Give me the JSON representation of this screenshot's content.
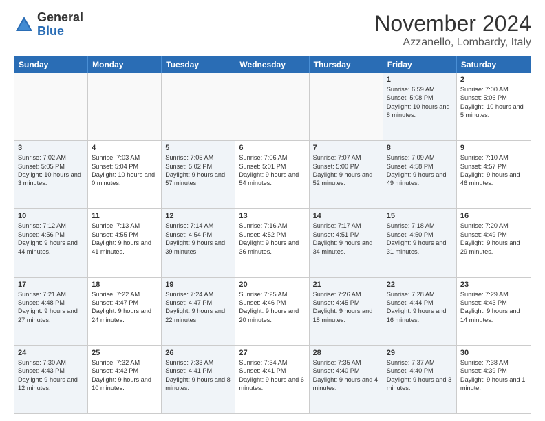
{
  "logo": {
    "general": "General",
    "blue": "Blue"
  },
  "title": "November 2024",
  "location": "Azzanello, Lombardy, Italy",
  "weekdays": [
    "Sunday",
    "Monday",
    "Tuesday",
    "Wednesday",
    "Thursday",
    "Friday",
    "Saturday"
  ],
  "rows": [
    [
      {
        "day": "",
        "info": "",
        "empty": true
      },
      {
        "day": "",
        "info": "",
        "empty": true
      },
      {
        "day": "",
        "info": "",
        "empty": true
      },
      {
        "day": "",
        "info": "",
        "empty": true
      },
      {
        "day": "",
        "info": "",
        "empty": true
      },
      {
        "day": "1",
        "info": "Sunrise: 6:59 AM\nSunset: 5:08 PM\nDaylight: 10 hours and 8 minutes.",
        "shaded": true
      },
      {
        "day": "2",
        "info": "Sunrise: 7:00 AM\nSunset: 5:06 PM\nDaylight: 10 hours and 5 minutes.",
        "shaded": false
      }
    ],
    [
      {
        "day": "3",
        "info": "Sunrise: 7:02 AM\nSunset: 5:05 PM\nDaylight: 10 hours and 3 minutes.",
        "shaded": true
      },
      {
        "day": "4",
        "info": "Sunrise: 7:03 AM\nSunset: 5:04 PM\nDaylight: 10 hours and 0 minutes.",
        "shaded": false
      },
      {
        "day": "5",
        "info": "Sunrise: 7:05 AM\nSunset: 5:02 PM\nDaylight: 9 hours and 57 minutes.",
        "shaded": true
      },
      {
        "day": "6",
        "info": "Sunrise: 7:06 AM\nSunset: 5:01 PM\nDaylight: 9 hours and 54 minutes.",
        "shaded": false
      },
      {
        "day": "7",
        "info": "Sunrise: 7:07 AM\nSunset: 5:00 PM\nDaylight: 9 hours and 52 minutes.",
        "shaded": true
      },
      {
        "day": "8",
        "info": "Sunrise: 7:09 AM\nSunset: 4:58 PM\nDaylight: 9 hours and 49 minutes.",
        "shaded": true
      },
      {
        "day": "9",
        "info": "Sunrise: 7:10 AM\nSunset: 4:57 PM\nDaylight: 9 hours and 46 minutes.",
        "shaded": false
      }
    ],
    [
      {
        "day": "10",
        "info": "Sunrise: 7:12 AM\nSunset: 4:56 PM\nDaylight: 9 hours and 44 minutes.",
        "shaded": true
      },
      {
        "day": "11",
        "info": "Sunrise: 7:13 AM\nSunset: 4:55 PM\nDaylight: 9 hours and 41 minutes.",
        "shaded": false
      },
      {
        "day": "12",
        "info": "Sunrise: 7:14 AM\nSunset: 4:54 PM\nDaylight: 9 hours and 39 minutes.",
        "shaded": true
      },
      {
        "day": "13",
        "info": "Sunrise: 7:16 AM\nSunset: 4:52 PM\nDaylight: 9 hours and 36 minutes.",
        "shaded": false
      },
      {
        "day": "14",
        "info": "Sunrise: 7:17 AM\nSunset: 4:51 PM\nDaylight: 9 hours and 34 minutes.",
        "shaded": true
      },
      {
        "day": "15",
        "info": "Sunrise: 7:18 AM\nSunset: 4:50 PM\nDaylight: 9 hours and 31 minutes.",
        "shaded": true
      },
      {
        "day": "16",
        "info": "Sunrise: 7:20 AM\nSunset: 4:49 PM\nDaylight: 9 hours and 29 minutes.",
        "shaded": false
      }
    ],
    [
      {
        "day": "17",
        "info": "Sunrise: 7:21 AM\nSunset: 4:48 PM\nDaylight: 9 hours and 27 minutes.",
        "shaded": true
      },
      {
        "day": "18",
        "info": "Sunrise: 7:22 AM\nSunset: 4:47 PM\nDaylight: 9 hours and 24 minutes.",
        "shaded": false
      },
      {
        "day": "19",
        "info": "Sunrise: 7:24 AM\nSunset: 4:47 PM\nDaylight: 9 hours and 22 minutes.",
        "shaded": true
      },
      {
        "day": "20",
        "info": "Sunrise: 7:25 AM\nSunset: 4:46 PM\nDaylight: 9 hours and 20 minutes.",
        "shaded": false
      },
      {
        "day": "21",
        "info": "Sunrise: 7:26 AM\nSunset: 4:45 PM\nDaylight: 9 hours and 18 minutes.",
        "shaded": true
      },
      {
        "day": "22",
        "info": "Sunrise: 7:28 AM\nSunset: 4:44 PM\nDaylight: 9 hours and 16 minutes.",
        "shaded": true
      },
      {
        "day": "23",
        "info": "Sunrise: 7:29 AM\nSunset: 4:43 PM\nDaylight: 9 hours and 14 minutes.",
        "shaded": false
      }
    ],
    [
      {
        "day": "24",
        "info": "Sunrise: 7:30 AM\nSunset: 4:43 PM\nDaylight: 9 hours and 12 minutes.",
        "shaded": true
      },
      {
        "day": "25",
        "info": "Sunrise: 7:32 AM\nSunset: 4:42 PM\nDaylight: 9 hours and 10 minutes.",
        "shaded": false
      },
      {
        "day": "26",
        "info": "Sunrise: 7:33 AM\nSunset: 4:41 PM\nDaylight: 9 hours and 8 minutes.",
        "shaded": true
      },
      {
        "day": "27",
        "info": "Sunrise: 7:34 AM\nSunset: 4:41 PM\nDaylight: 9 hours and 6 minutes.",
        "shaded": false
      },
      {
        "day": "28",
        "info": "Sunrise: 7:35 AM\nSunset: 4:40 PM\nDaylight: 9 hours and 4 minutes.",
        "shaded": true
      },
      {
        "day": "29",
        "info": "Sunrise: 7:37 AM\nSunset: 4:40 PM\nDaylight: 9 hours and 3 minutes.",
        "shaded": true
      },
      {
        "day": "30",
        "info": "Sunrise: 7:38 AM\nSunset: 4:39 PM\nDaylight: 9 hours and 1 minute.",
        "shaded": false
      }
    ]
  ]
}
